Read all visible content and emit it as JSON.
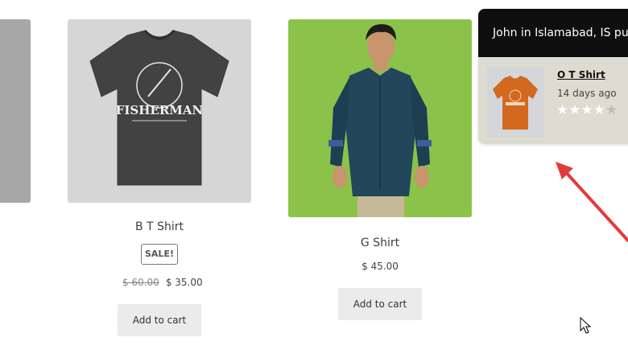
{
  "products": [
    {
      "title": "B T Shirt",
      "sale_badge": "SALE!",
      "old_price": "$ 60.00",
      "price": "$ 35.00",
      "button": "Add to cart"
    },
    {
      "title": "G Shirt",
      "price": "$ 45.00",
      "button": "Add to cart"
    }
  ],
  "popup": {
    "header": "John in Islamabad, IS pu",
    "product": "O T Shirt",
    "time": "14 days ago",
    "rating": 4,
    "rating_max": 5,
    "header_bg": "#0f0f0f",
    "body_bg": "#dedcd1"
  },
  "tshirt_print": "FISHERMAN",
  "icons": [
    "arrow-annotation-icon",
    "mouse-cursor-icon",
    "star-icon"
  ]
}
